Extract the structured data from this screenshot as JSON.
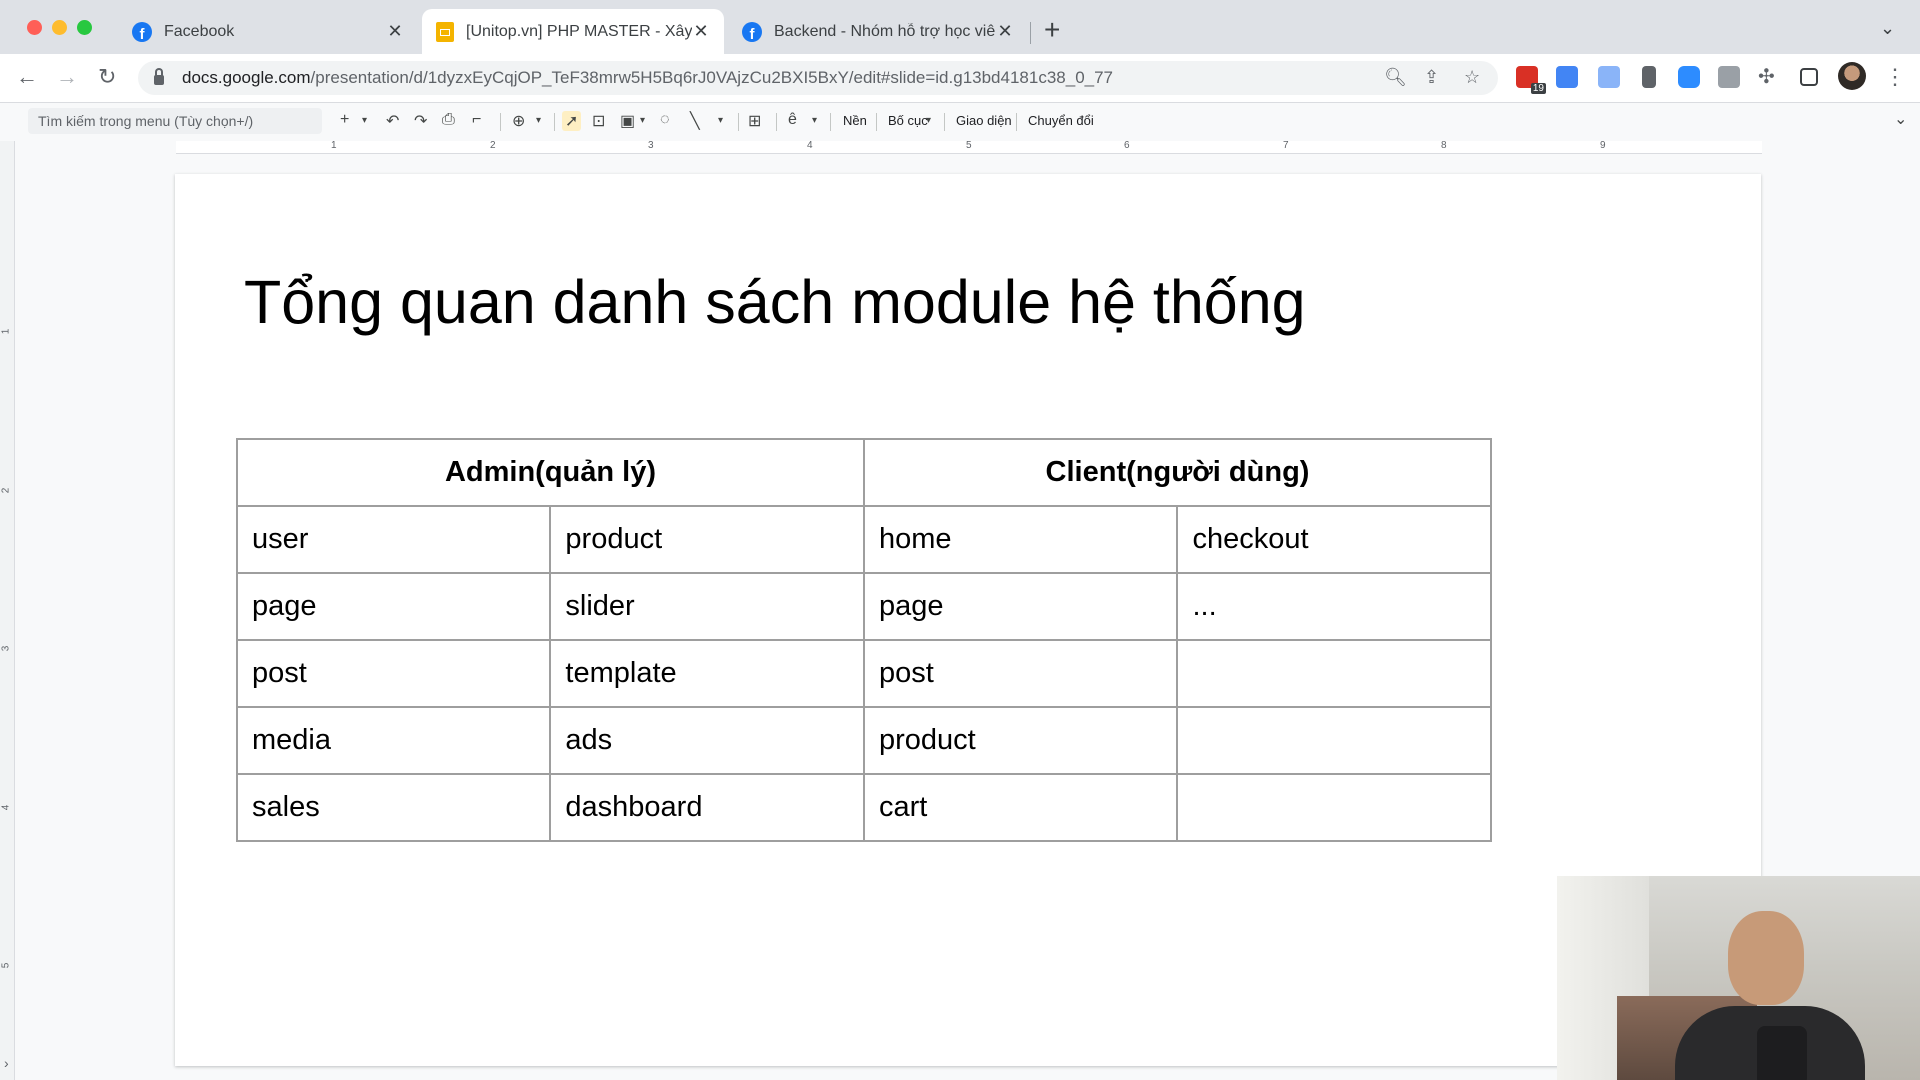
{
  "browser": {
    "tabs": [
      {
        "title": "Facebook",
        "icon": "facebook-icon",
        "active": false
      },
      {
        "title": "[Unitop.vn] PHP MASTER - Xây",
        "icon": "google-slides-icon",
        "active": true
      },
      {
        "title": "Backend - Nhóm hỗ trợ học viê",
        "icon": "facebook-icon",
        "active": false
      }
    ],
    "new_tab_label": "+",
    "url_host": "docs.google.com",
    "url_path": "/presentation/d/1dyzxEyCqjOP_TeF38mrw5H5Bq6rJ0VAjzCu2BXI5BxY/edit#slide=id.g13bd4181c38_0_77",
    "extension_badge": "19"
  },
  "slides_toolbar": {
    "menu_search_placeholder": "Tìm kiếm trong menu (Tùy chọn+/)",
    "background_label": "Nền",
    "layout_label": "Bố cục",
    "theme_label": "Giao diện",
    "transition_label": "Chuyển đổi"
  },
  "ruler": {
    "top_numbers": [
      "1",
      "2",
      "3",
      "4",
      "5",
      "6",
      "7",
      "8",
      "9"
    ],
    "left_numbers": [
      "1",
      "2",
      "3",
      "4",
      "5"
    ]
  },
  "slide": {
    "title": "Tổng quan danh sách module hệ thống",
    "table": {
      "headers": [
        "Admin(quản lý)",
        "Client(người dùng)"
      ],
      "rows": [
        [
          "user",
          "product",
          "home",
          "checkout"
        ],
        [
          "page",
          "slider",
          "page",
          "..."
        ],
        [
          "post",
          "template",
          "post",
          ""
        ],
        [
          "media",
          "ads",
          "product",
          ""
        ],
        [
          "sales",
          "dashboard",
          "cart",
          ""
        ]
      ]
    }
  },
  "colors": {
    "tabstrip": "#dee1e6",
    "slides_accent": "#f4b400",
    "facebook_blue": "#1877f2"
  }
}
